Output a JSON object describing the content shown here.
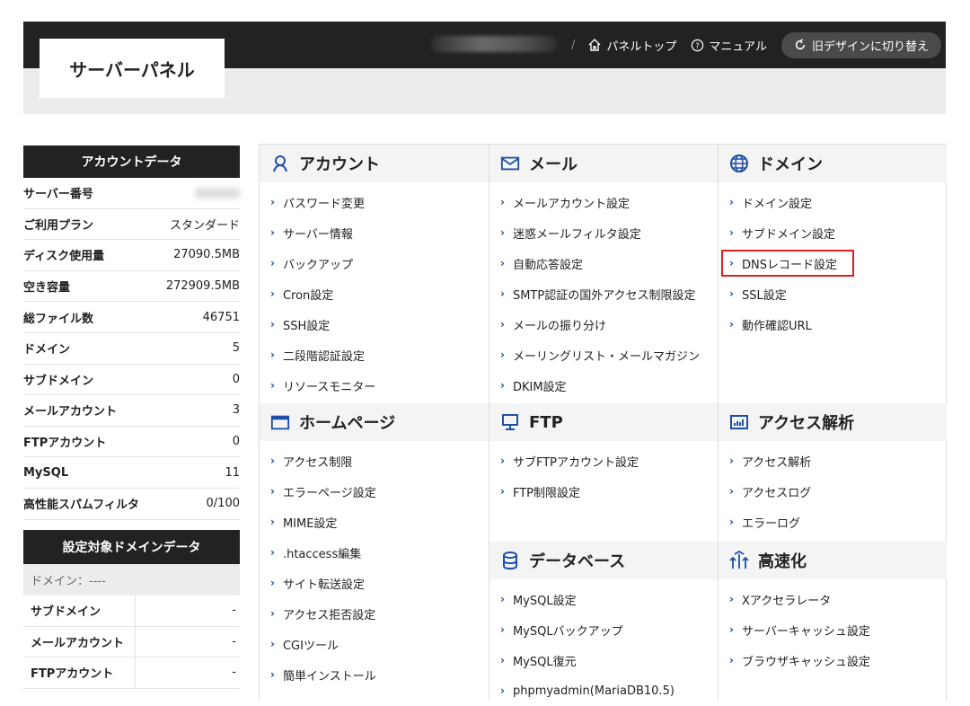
{
  "header": {
    "logo": "サーバーパネル",
    "separator": "/",
    "panel_top": "パネルトップ",
    "manual": "マニュアル",
    "old_design": "旧デザインに切り替え"
  },
  "account": {
    "title": "アカウントデータ",
    "rows": [
      {
        "label": "サーバー番号",
        "value": ""
      },
      {
        "label": "ご利用プラン",
        "value": "スタンダード"
      },
      {
        "label": "ディスク使用量",
        "value": "27090.5MB"
      },
      {
        "label": "空き容量",
        "value": "272909.5MB"
      },
      {
        "label": "総ファイル数",
        "value": "46751"
      },
      {
        "label": "ドメイン",
        "value": "5"
      },
      {
        "label": "サブドメイン",
        "value": "0"
      },
      {
        "label": "メールアカウント",
        "value": "3"
      },
      {
        "label": "FTPアカウント",
        "value": "0"
      },
      {
        "label": "MySQL",
        "value": "11"
      },
      {
        "label": "高性能スパムフィルタ",
        "value": "0/100"
      }
    ]
  },
  "domain_data": {
    "title": "設定対象ドメインデータ",
    "domain": "ドメイン：----",
    "rows": [
      {
        "label": "サブドメイン",
        "value": "-"
      },
      {
        "label": "メールアカウント",
        "value": "-"
      },
      {
        "label": "FTPアカウント",
        "value": "-"
      }
    ]
  },
  "sections": {
    "account": {
      "title": "アカウント",
      "items": [
        "パスワード変更",
        "サーバー情報",
        "バックアップ",
        "Cron設定",
        "SSH設定",
        "二段階認証設定",
        "リソースモニター"
      ]
    },
    "mail": {
      "title": "メール",
      "items": [
        "メールアカウント設定",
        "迷惑メールフィルタ設定",
        "自動応答設定",
        "SMTP認証の国外アクセス制限設定",
        "メールの振り分け",
        "メーリングリスト・メールマガジン",
        "DKIM設定"
      ]
    },
    "domain": {
      "title": "ドメイン",
      "items": [
        "ドメイン設定",
        "サブドメイン設定",
        "DNSレコード設定",
        "SSL設定",
        "動作確認URL"
      ]
    },
    "homepage": {
      "title": "ホームページ",
      "items": [
        "アクセス制限",
        "エラーページ設定",
        "MIME設定",
        ".htaccess編集",
        "サイト転送設定",
        "アクセス拒否設定",
        "CGIツール",
        "簡単インストール"
      ]
    },
    "ftp": {
      "title": "FTP",
      "items": [
        "サブFTPアカウント設定",
        "FTP制限設定"
      ]
    },
    "analytics": {
      "title": "アクセス解析",
      "items": [
        "アクセス解析",
        "アクセスログ",
        "エラーログ"
      ]
    },
    "database": {
      "title": "データベース",
      "items": [
        "MySQL設定",
        "MySQLバックアップ",
        "MySQL復元",
        "phpmyadmin(MariaDB10.5)"
      ]
    },
    "speed": {
      "title": "高速化",
      "items": [
        "Xアクセラレータ",
        "サーバーキャッシュ設定",
        "ブラウザキャッシュ設定"
      ]
    }
  },
  "colors": {
    "accent": "#1e4fa8",
    "highlight": "#e02020",
    "header_bg": "#222222"
  }
}
